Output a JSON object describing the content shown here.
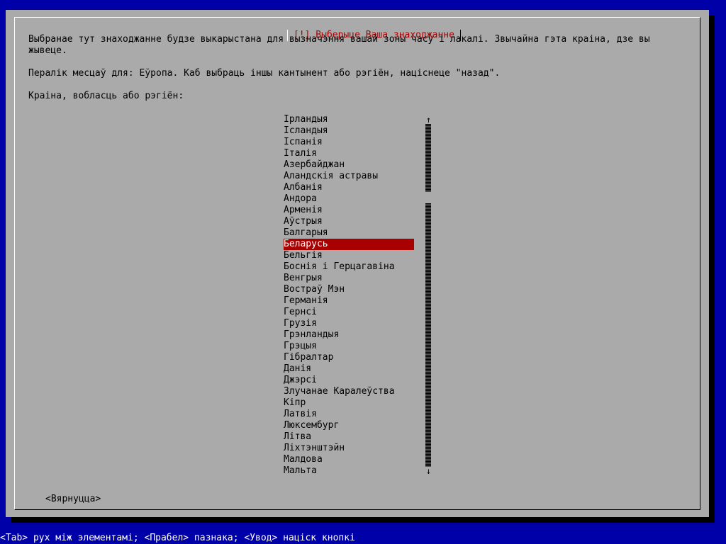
{
  "dialog": {
    "title": "[!] Выберыце Ваша знаходжанне",
    "description_line1": "Выбранае тут знаходжанне будзе выкарыстана для вызначэння вашай зоны часу і лакалі. Звычайна гэта краіна, дзе вы",
    "description_line2": "жывеце.",
    "region_note": "Пералік месцаў для: Еўропа. Каб выбраць іншы кантынент або рэгіён, націсне‌це \"назад\".",
    "list_label": "Краіна, вобласць або рэгіён:",
    "back_button": "<Вярнуцца>"
  },
  "countries": [
    "Ірландыя",
    "Ісландыя",
    "Іспанія",
    "Італія",
    "Азербайджан",
    "Аландскія астравы",
    "Албанія",
    "Андора",
    "Арменія",
    "Аўстрыя",
    "Балгарыя",
    "Беларусь",
    "Бельгія",
    "Боснія і Герцагавіна",
    "Венгрыя",
    "Востраў Мэн",
    "Германія",
    "Гернсі",
    "Грузія",
    "Грэнландыя",
    "Грэцыя",
    "Гібралтар",
    "Данія",
    "Джэрсі",
    "Злучанае Каралеўства",
    "Кіпр",
    "Латвія",
    "Люксембург",
    "Літва",
    "Ліхтэнштэйн",
    "Малдова",
    "Мальта"
  ],
  "selected_country": "Беларусь",
  "status_bar": "<Tab> рух між элементамі; <Прабел> пазнака; <Увод> націск кнопкі",
  "scrollbar": {
    "up_arrow": "↑",
    "down_arrow": "↓",
    "position_fraction": 0.24
  },
  "colors": {
    "screen_background": "#0000a8",
    "dialog_background": "#aaaaaa",
    "title_text": "#a80000",
    "selection_background": "#a80000",
    "selection_text": "#ffffff",
    "status_text": "#ffffff"
  }
}
